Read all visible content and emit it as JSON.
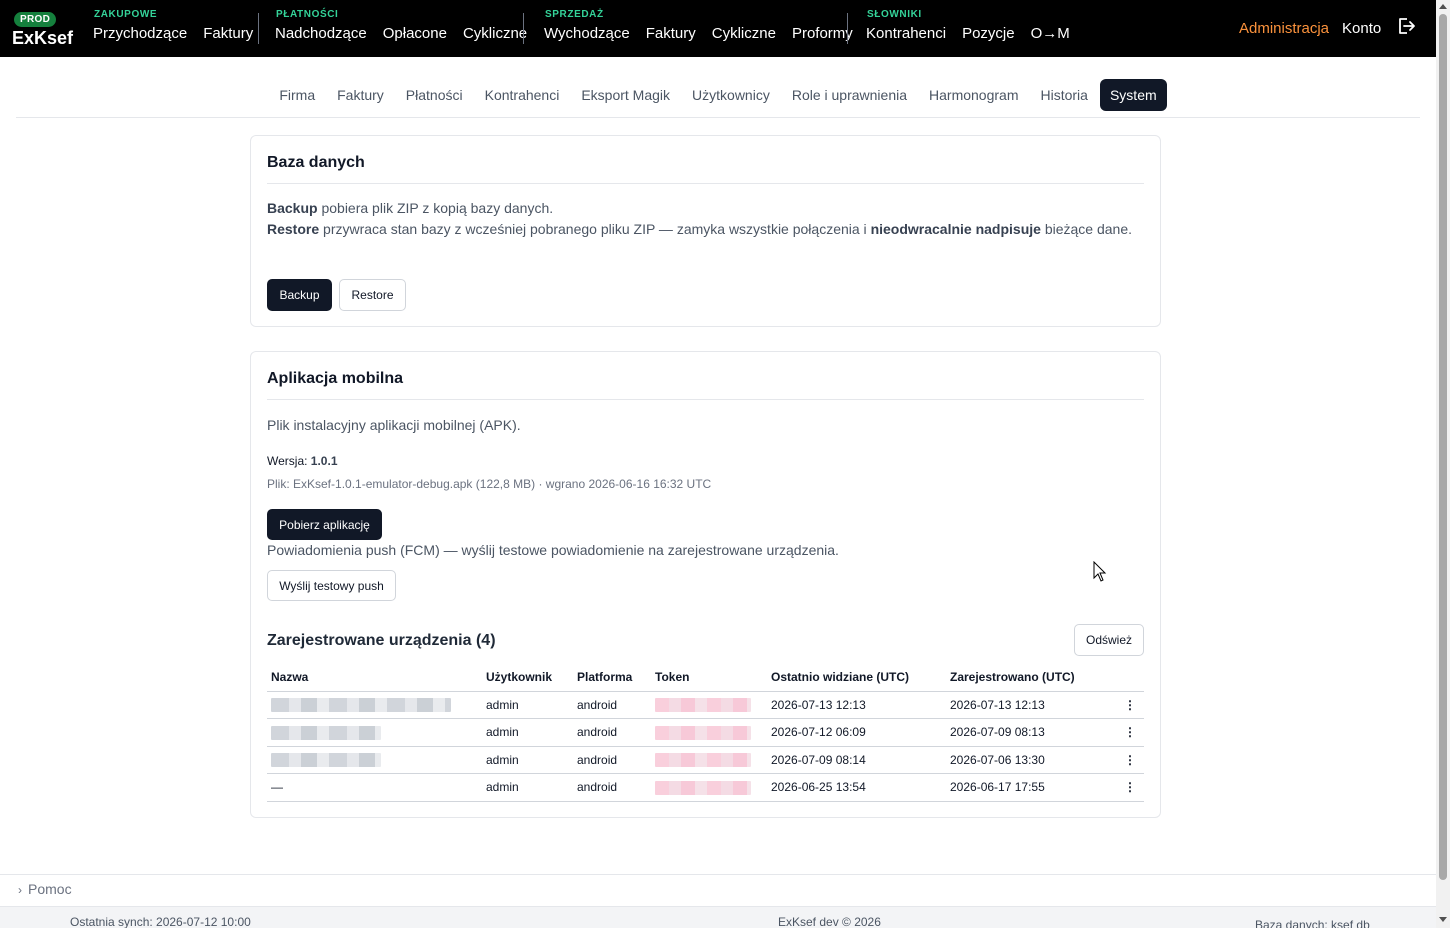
{
  "brand": {
    "badge": "PROD",
    "name": "ExKsef"
  },
  "nav": {
    "groups": [
      {
        "label": "ZAKUPOWE",
        "items": [
          "Przychodzące",
          "Faktury"
        ]
      },
      {
        "label": "PŁATNOŚCI",
        "items": [
          "Nadchodzące",
          "Opłacone",
          "Cykliczne"
        ]
      },
      {
        "label": "SPRZEDAŻ",
        "items": [
          "Wychodzące",
          "Faktury",
          "Cykliczne",
          "Proformy"
        ]
      },
      {
        "label": "SŁOWNIKI",
        "items": [
          "Kontrahenci",
          "Pozycje",
          "O→M"
        ]
      }
    ],
    "admin": "Administracja",
    "account": "Konto",
    "logout_icon": "logout-icon"
  },
  "tabs": [
    "Firma",
    "Faktury",
    "Płatności",
    "Kontrahenci",
    "Eksport Magik",
    "Użytkownicy",
    "Role i uprawnienia",
    "Harmonogram",
    "Historia",
    "System"
  ],
  "active_tab": "System",
  "database": {
    "title": "Baza danych",
    "backup_bold": "Backup",
    "backup_text": " pobiera plik ZIP z kopią bazy danych.",
    "restore_bold": "Restore",
    "restore_text1": " przywraca stan bazy z wcześniej pobranego pliku ZIP — zamyka wszystkie połączenia i ",
    "restore_bold2": "nieodwracalnie nadpisuje",
    "restore_text2": " bieżące dane.",
    "backup_button": "Backup",
    "restore_button": "Restore"
  },
  "mobile": {
    "title": "Aplikacja mobilna",
    "description": "Plik instalacyjny aplikacji mobilnej (APK).",
    "version_label": "Wersja: ",
    "version": "1.0.1",
    "file_info": "Plik: ExKsef-1.0.1-emulator-debug.apk (122,8 MB) · wgrano 2026-06-16 16:32 UTC",
    "download_button": "Pobierz aplikację",
    "push_text": "Powiadomienia push (FCM) — wyślij testowe powiadomienie na zarejestrowane urządzenia.",
    "push_button": "Wyślij testowy push"
  },
  "devices": {
    "title": "Zarejestrowane urządzenia (4)",
    "refresh_button": "Odśwież",
    "columns": [
      "Nazwa",
      "Użytkownik",
      "Platforma",
      "Token",
      "Ostatnio widziane (UTC)",
      "Zarejestrowano (UTC)"
    ],
    "rows": [
      {
        "name": "",
        "user": "admin",
        "platform": "android",
        "token": "",
        "last_seen": "2026-07-13 12:13",
        "registered": "2026-07-13 12:13"
      },
      {
        "name": "",
        "user": "admin",
        "platform": "android",
        "token": "",
        "last_seen": "2026-07-12 06:09",
        "registered": "2026-07-09 08:13"
      },
      {
        "name": "",
        "user": "admin",
        "platform": "android",
        "token": "",
        "last_seen": "2026-07-09 08:14",
        "registered": "2026-07-06 13:30"
      },
      {
        "name": "—",
        "user": "admin",
        "platform": "android",
        "token": "",
        "last_seen": "2026-06-25 13:54",
        "registered": "2026-06-17 17:55"
      }
    ],
    "row_menu_icon": "more-vertical-icon"
  },
  "help": {
    "label": "Pomoc"
  },
  "footer": {
    "sync": "Ostatnia synch: 2026-07-12 10:00",
    "copyright": "ExKsef dev © 2026",
    "database": "Baza danych: ksef db"
  },
  "colors": {
    "nav_bg": "#000000",
    "group_label": "#34d399",
    "admin": "#fb923c",
    "prod_badge": "#15803d",
    "dark_button": "#111827"
  }
}
